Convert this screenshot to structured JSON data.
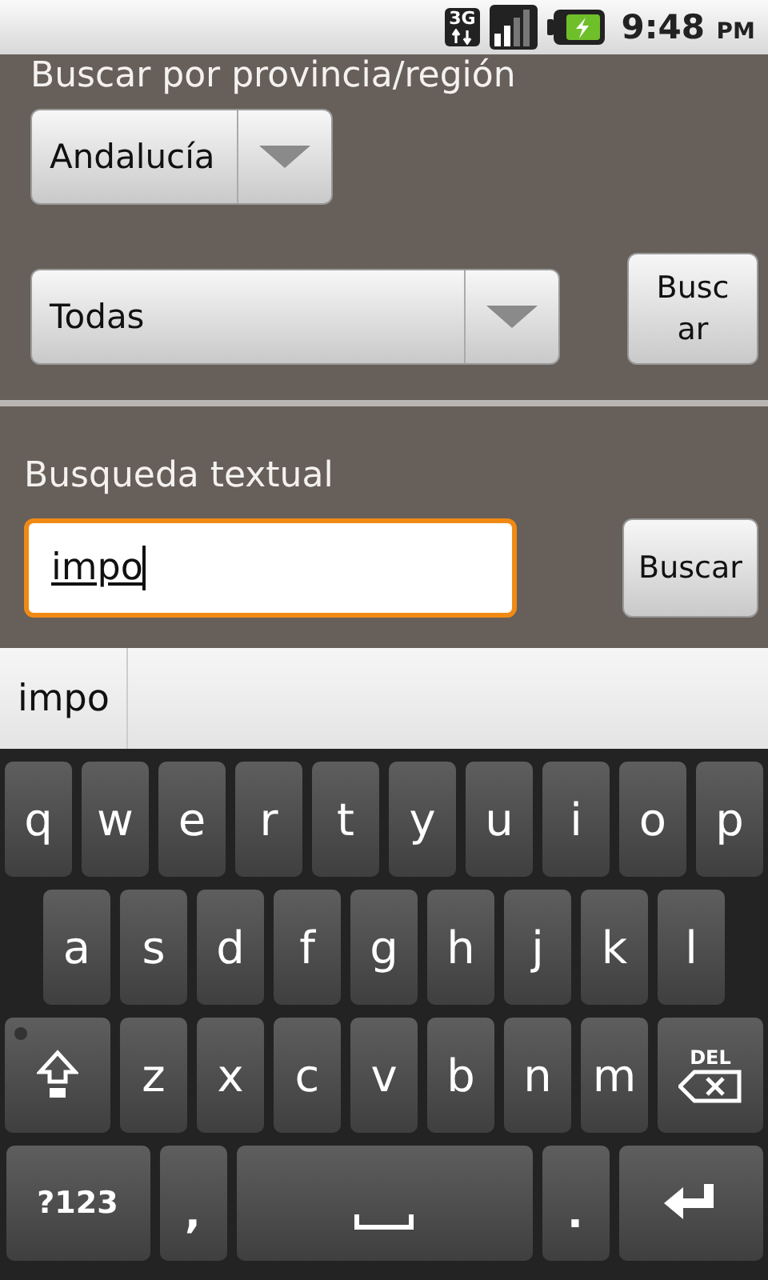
{
  "status_bar": {
    "network": "3G",
    "time": "9:48",
    "ampm": "PM"
  },
  "province_search": {
    "heading": "Buscar por provincia/región",
    "region_spinner": {
      "value": "Andalucía"
    },
    "type_spinner": {
      "value": "Todas"
    },
    "button": "Buscar"
  },
  "text_search": {
    "heading": "Busqueda textual",
    "field": {
      "value": "impo",
      "focused": true
    },
    "button": "Buscar"
  },
  "suggestions": [
    "impo"
  ],
  "keyboard": {
    "rows": [
      [
        {
          "kind": "char",
          "label": "q"
        },
        {
          "kind": "char",
          "label": "w"
        },
        {
          "kind": "char",
          "label": "e"
        },
        {
          "kind": "char",
          "label": "r"
        },
        {
          "kind": "char",
          "label": "t"
        },
        {
          "kind": "char",
          "label": "y"
        },
        {
          "kind": "char",
          "label": "u"
        },
        {
          "kind": "char",
          "label": "i"
        },
        {
          "kind": "char",
          "label": "o"
        },
        {
          "kind": "char",
          "label": "p"
        }
      ],
      [
        {
          "kind": "char",
          "label": "a"
        },
        {
          "kind": "char",
          "label": "s"
        },
        {
          "kind": "char",
          "label": "d"
        },
        {
          "kind": "char",
          "label": "f"
        },
        {
          "kind": "char",
          "label": "g"
        },
        {
          "kind": "char",
          "label": "h"
        },
        {
          "kind": "char",
          "label": "j"
        },
        {
          "kind": "char",
          "label": "k"
        },
        {
          "kind": "char",
          "label": "l"
        }
      ],
      [
        {
          "kind": "shift"
        },
        {
          "kind": "char",
          "label": "z"
        },
        {
          "kind": "char",
          "label": "x"
        },
        {
          "kind": "char",
          "label": "c"
        },
        {
          "kind": "char",
          "label": "v"
        },
        {
          "kind": "char",
          "label": "b"
        },
        {
          "kind": "char",
          "label": "n"
        },
        {
          "kind": "char",
          "label": "m"
        },
        {
          "kind": "delete",
          "label": "DEL"
        }
      ],
      [
        {
          "kind": "symbols",
          "label": "?123"
        },
        {
          "kind": "punct",
          "label": ","
        },
        {
          "kind": "space"
        },
        {
          "kind": "punct",
          "label": "."
        },
        {
          "kind": "enter"
        }
      ]
    ]
  }
}
